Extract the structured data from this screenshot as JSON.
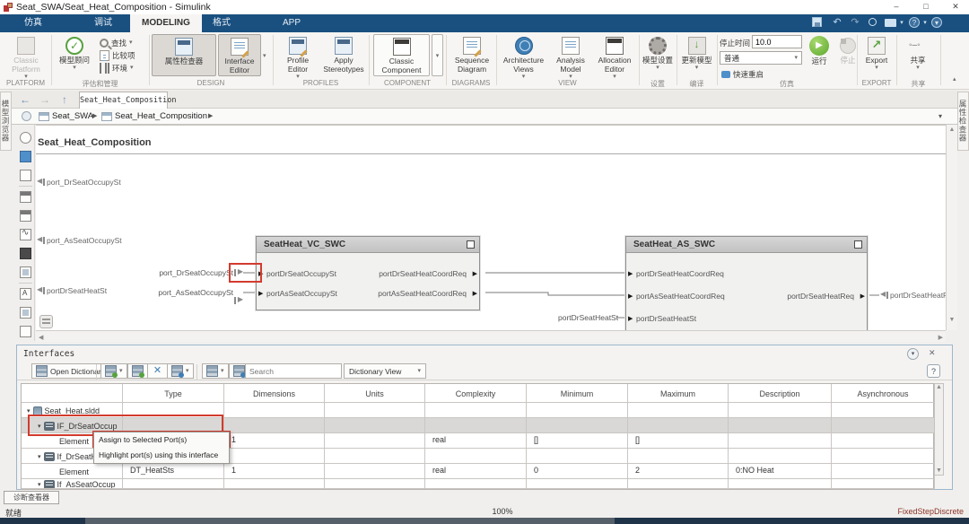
{
  "titlebar": {
    "title": "Seat_SWA/Seat_Heat_Composition - Simulink"
  },
  "icons": {
    "minimize": "–",
    "maximize": "□",
    "close": "✕",
    "caret_down": "▾",
    "caret_up": "▴",
    "tri_left": "◀",
    "tri_right": "▶",
    "tri_up": "▲",
    "tri_down": "▼",
    "arrow_back": "←",
    "arrow_fwd": "→",
    "arrow_up": "↑",
    "undo": "↶",
    "redo": "↷",
    "check": "✓",
    "question": "?",
    "play": "▶",
    "breadcrumb_sep": "▶",
    "expander": "▾",
    "menu_circle": "▾"
  },
  "tabbar": {
    "tabs": [
      {
        "label": "仿真"
      },
      {
        "label": "调试"
      },
      {
        "label": "MODELING"
      },
      {
        "label": "格式"
      },
      {
        "label": "APP"
      }
    ]
  },
  "ribbon": {
    "group_labels": [
      "PLATFORM",
      "评估和管理",
      "DESIGN",
      "PROFILES",
      "COMPONENT",
      "DIAGRAMS",
      "VIEW",
      "设置",
      "编译",
      "仿真",
      "EXPORT",
      "共享"
    ],
    "classic_platform": "Classic Platform",
    "model_advisor": "模型顾问",
    "find": "查找",
    "compare": "比较项",
    "environment": "环境",
    "property_inspector": "属性检查器",
    "interface_editor": "Interface Editor",
    "profile_editor": "Profile Editor",
    "apply_stereotypes": "Apply Stereotypes",
    "classic_component": "Classic Component",
    "sequence_diagram": "Sequence Diagram",
    "architecture_views": "Architecture Views",
    "analysis_model": "Analysis Model",
    "allocation_editor": "Allocation Editor",
    "model_settings": "模型设置",
    "update_model": "更新模型",
    "stop_time_label": "停止时间",
    "stop_time_value": "10.0",
    "sim_mode": "普通",
    "fast_restart": "快速重启",
    "run": "运行",
    "stop": "停止",
    "export": "Export",
    "share": "共享"
  },
  "navbar": {
    "doc_tab": "Seat_Heat_Composition"
  },
  "breadcrumb": {
    "items": [
      "Seat_SWA",
      "Seat_Heat_Composition"
    ]
  },
  "side_strips": {
    "left": "模型浏览器",
    "right": "属性检查器"
  },
  "canvas": {
    "title": "Seat_Heat_Composition",
    "boundary_inputs": [
      "port_DrSeatOccupySt",
      "port_AsSeatOccupySt",
      "portDrSeatHeatSt"
    ],
    "vc_input_refs": [
      "port_DrSeatOccupySt",
      "port_AsSeatOccupySt"
    ],
    "as_input_ref": "portDrSeatHeatSt",
    "as_output_ref": "portDrSeatHeatRe",
    "blocks": [
      {
        "name": "SeatHeat_VC_SWC",
        "inputs": [
          "portDrSeatOccupySt",
          "portAsSeatOccupySt"
        ],
        "outputs": [
          "portDrSeatHeatCoordReq",
          "portAsSeatHeatCoordReq"
        ]
      },
      {
        "name": "SeatHeat_AS_SWC",
        "inputs": [
          "portDrSeatHeatCoordReq",
          "portAsSeatHeatCoordReq",
          "portDrSeatHeatSt"
        ],
        "outputs": [
          "portDrSeatHeatReq"
        ]
      }
    ]
  },
  "interfaces": {
    "title": "Interfaces",
    "open_dictionary": "Open Dictionary",
    "search_placeholder": "Search",
    "view_mode": "Dictionary View",
    "help": "?",
    "columns": [
      "Type",
      "Dimensions",
      "Units",
      "Complexity",
      "Minimum",
      "Maximum",
      "Description",
      "Asynchronous"
    ],
    "rows": [
      {
        "name": "Seat_Heat.sldd",
        "type": "",
        "dimensions": "",
        "units": "",
        "complexity": "",
        "minimum": "",
        "maximum": "",
        "description": "",
        "asynchronous": ""
      },
      {
        "name": "IF_DrSeatOccup",
        "type": "",
        "dimensions": "",
        "units": "",
        "complexity": "",
        "minimum": "",
        "maximum": "",
        "description": "",
        "asynchronous": ""
      },
      {
        "name": "Element",
        "type": "",
        "dimensions": "1",
        "units": "",
        "complexity": "real",
        "minimum": "[]",
        "maximum": "[]",
        "description": "",
        "asynchronous": ""
      },
      {
        "name": "If_DrSeatH",
        "type": "",
        "dimensions": "",
        "units": "",
        "complexity": "",
        "minimum": "",
        "maximum": "",
        "description": "",
        "asynchronous": ""
      },
      {
        "name": "Element",
        "type": "DT_HeatSts",
        "dimensions": "1",
        "units": "",
        "complexity": "real",
        "minimum": "0",
        "maximum": "2",
        "description": "0:NO Heat",
        "asynchronous": ""
      },
      {
        "name": "If_AsSeatOccup",
        "type": "",
        "dimensions": "",
        "units": "",
        "complexity": "",
        "minimum": "",
        "maximum": "",
        "description": "",
        "asynchronous": ""
      }
    ],
    "context_menu": [
      "Assign to Selected Port(s)",
      "Highlight port(s) using this interface"
    ]
  },
  "statusbar": {
    "diagnostic_viewer": "诊断查看器",
    "ready": "就绪",
    "zoom": "100%",
    "solver": "FixedStepDiscrete"
  },
  "colors": {
    "tab_blue": "#1a5080",
    "selection_red": "#d23b2e",
    "run_green": "#5ca82e",
    "solver_text": "#8b3327"
  }
}
